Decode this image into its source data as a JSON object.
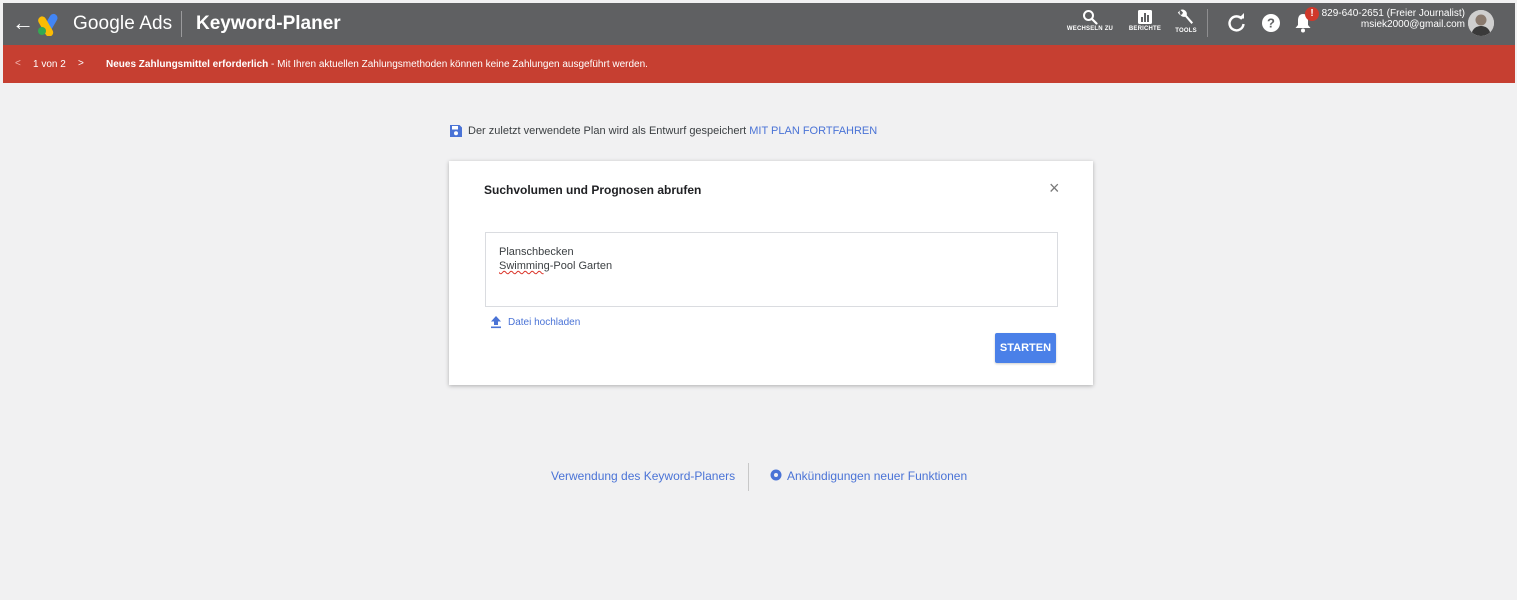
{
  "topbar": {
    "back_icon": "arrow-left-icon",
    "brand": "Google Ads",
    "page_title": "Keyword-Planer",
    "tools": [
      {
        "label": "WECHSELN ZU",
        "icon": "search-icon"
      },
      {
        "label": "BERICHTE",
        "icon": "bar-chart-icon"
      },
      {
        "label": "TOOLS",
        "icon": "wrench-icon"
      }
    ],
    "notification_badge": "!",
    "account_line1": "829-640-2651 (Freier Journalist)",
    "account_line2": "msiek2000@gmail.com",
    "bar_color": "#5f6062"
  },
  "alert": {
    "pager": "1 von 2",
    "prev_icon": "<",
    "next_icon": ">",
    "title": "Neues Zahlungsmittel erforderlich",
    "text": " - Mit Ihren aktuellen Zahlungsmethoden können keine Zahlungen ausgeführt werden.",
    "color": "#c63f31"
  },
  "draft_notice": {
    "text": "Der zuletzt verwendete Plan wird als Entwurf gespeichert",
    "link": "MIT PLAN FORTFAHREN"
  },
  "card": {
    "title": "Suchvolumen und Prognosen abrufen",
    "close_icon": "×",
    "keywords": [
      "Planschbecken",
      "Swimming-Pool Garten"
    ],
    "keyword_misspelled_part": "Swimming",
    "keyword_rest": "-Pool Garten",
    "upload_label": "Datei hochladen",
    "start_button": "STARTEN",
    "accent": "#4a80e8"
  },
  "footer": {
    "link1": "Verwendung des Keyword-Planers",
    "link2": "Ankündigungen neuer Funktionen"
  }
}
